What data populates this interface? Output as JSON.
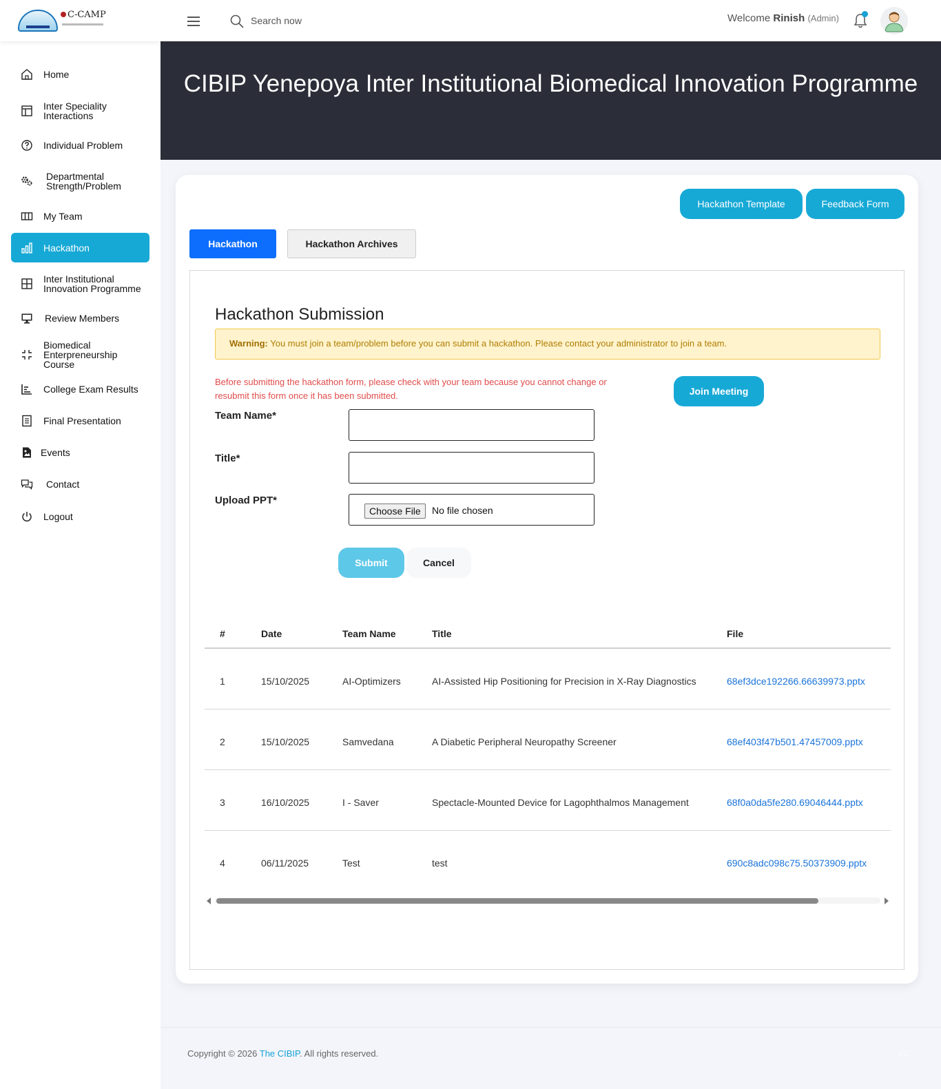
{
  "header": {
    "logo_text": "C-CAMP",
    "search_placeholder": "Search now",
    "welcome_prefix": "Welcome",
    "user_name": "Rinish",
    "user_role": "(Admin)"
  },
  "sidebar": {
    "items": [
      {
        "label": "Home",
        "icon": "home-icon"
      },
      {
        "label": "Inter Speciality Interactions",
        "icon": "layout-icon"
      },
      {
        "label": "Individual Problem",
        "icon": "question-circle-icon"
      },
      {
        "label": "Departmental Strength/Problem",
        "icon": "gears-icon"
      },
      {
        "label": "My Team",
        "icon": "columns-icon"
      },
      {
        "label": "Hackathon",
        "icon": "bar-chart-icon",
        "active": true
      },
      {
        "label": "Inter Institutional Innovation Programme",
        "icon": "grid-icon"
      },
      {
        "label": "Review Members",
        "icon": "monitor-icon"
      },
      {
        "label": "Biomedical Enterpreneurship Course",
        "icon": "shrink-icon"
      },
      {
        "label": "College Exam Results",
        "icon": "chart-list-icon"
      },
      {
        "label": "Final Presentation",
        "icon": "document-icon"
      },
      {
        "label": "Events",
        "icon": "image-file-icon"
      },
      {
        "label": "Contact",
        "icon": "chat-icon"
      },
      {
        "label": "Logout",
        "icon": "power-icon"
      }
    ]
  },
  "hero": {
    "title": "CIBIP Yenepoya Inter Institutional Biomedical Innovation Programme"
  },
  "actions": {
    "template_label": "Hackathon Template",
    "feedback_label": "Feedback Form"
  },
  "tabs": [
    {
      "label": "Hackathon",
      "active": true
    },
    {
      "label": "Hackathon Archives",
      "active": false
    }
  ],
  "form": {
    "heading": "Hackathon Submission",
    "warning_strong": "Warning:",
    "warning_text": "You must join a team/problem before you can submit a hackathon. Please contact your administrator to join a team.",
    "note": "Before submitting the hackathon form, please check with your team because you cannot change or resubmit this form once it has been submitted.",
    "join_label": "Join Meeting",
    "team_name_label": "Team Name*",
    "team_name_value": "",
    "title_label": "Title*",
    "title_value": "",
    "upload_label": "Upload PPT*",
    "choose_file_label": "Choose File",
    "file_status": "No file chosen",
    "submit_label": "Submit",
    "cancel_label": "Cancel"
  },
  "table": {
    "headers": [
      "#",
      "Date",
      "Team Name",
      "Title",
      "File"
    ],
    "rows": [
      [
        "1",
        "15/10/2025",
        "AI-Optimizers",
        "AI-Assisted Hip Positioning for Precision in X-Ray Diagnostics",
        "68ef3dce192266.66639973.pptx"
      ],
      [
        "2",
        "15/10/2025",
        "Samvedana",
        "A Diabetic Peripheral Neuropathy Screener",
        "68ef403f47b501.47457009.pptx"
      ],
      [
        "3",
        "16/10/2025",
        "I - Saver",
        "Spectacle-Mounted Device for Lagophthalmos Management",
        "68f0a0da5fe280.69046444.pptx"
      ],
      [
        "4",
        "06/11/2025",
        "Test",
        "test",
        "690c8adc098c75.50373909.pptx"
      ]
    ]
  },
  "footer": {
    "copyright_prefix": "Copyright © 2026",
    "brand_link": "The CIBIP",
    "copyright_suffix": ". All rights reserved.",
    "version": "V1"
  },
  "colors": {
    "accent": "#17a9d6",
    "tab_active": "#0d6efd",
    "hero_bg": "#2b2e38",
    "warning_bg": "#fff3cd",
    "note_text": "#e04b4b",
    "link": "#1a73d9"
  }
}
